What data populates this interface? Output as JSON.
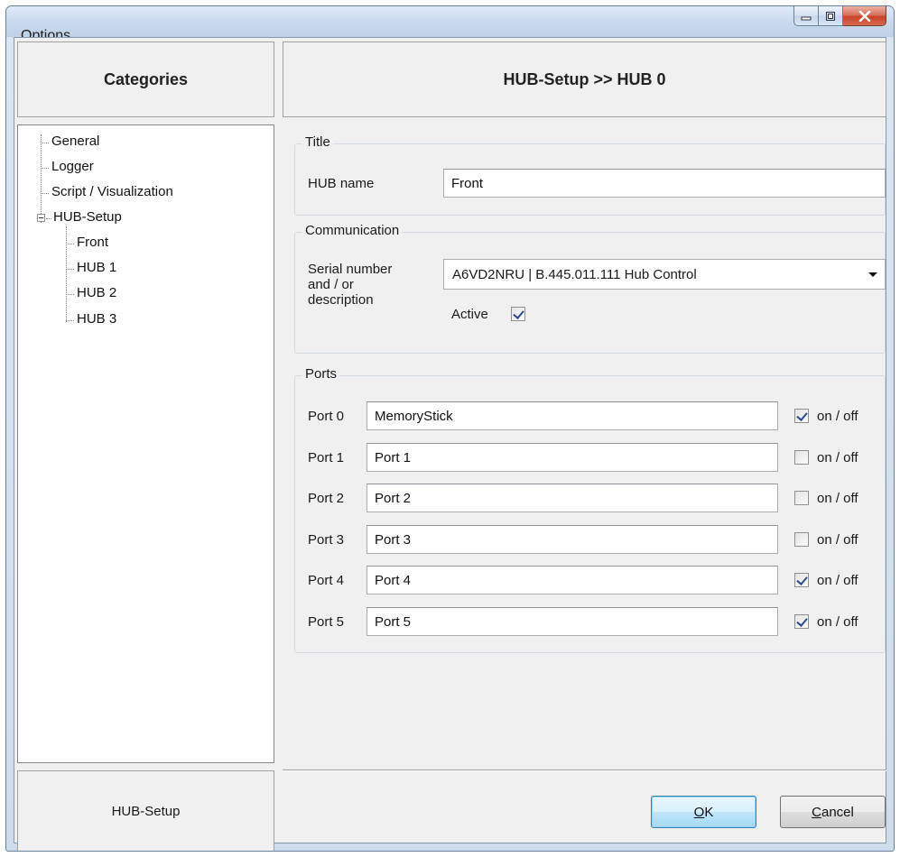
{
  "window": {
    "title": "Options"
  },
  "left_panel": {
    "header": "Categories",
    "tree": {
      "items": [
        {
          "label": "General"
        },
        {
          "label": "Logger"
        },
        {
          "label": "Script / Visualization"
        },
        {
          "label": "HUB-Setup"
        },
        {
          "label": "Front"
        },
        {
          "label": "HUB 1"
        },
        {
          "label": "HUB 2"
        },
        {
          "label": "HUB 3"
        }
      ]
    },
    "footer": "HUB-Setup"
  },
  "right_panel": {
    "header": "HUB-Setup >> HUB 0",
    "title_group": {
      "legend": "Title",
      "hub_name_label": "HUB name",
      "hub_name_value": "Front"
    },
    "communication_group": {
      "legend": "Communication",
      "serial_label_line1": "Serial number",
      "serial_label_line2": "and / or",
      "serial_label_line3": "description",
      "serial_value": "A6VD2NRU | B.445.011.111 Hub Control",
      "active_label": "Active",
      "active_checked": true
    },
    "ports_group": {
      "legend": "Ports",
      "ports": [
        {
          "label": "Port 0",
          "value": "MemoryStick",
          "toggle_label": "on / off",
          "checked": true
        },
        {
          "label": "Port 1",
          "value": "Port 1",
          "toggle_label": "on / off",
          "checked": false
        },
        {
          "label": "Port 2",
          "value": "Port 2",
          "toggle_label": "on / off",
          "checked": false
        },
        {
          "label": "Port 3",
          "value": "Port 3",
          "toggle_label": "on / off",
          "checked": false
        },
        {
          "label": "Port 4",
          "value": "Port 4",
          "toggle_label": "on / off",
          "checked": true
        },
        {
          "label": "Port 5",
          "value": "Port 5",
          "toggle_label": "on / off",
          "checked": true
        }
      ]
    }
  },
  "buttons": {
    "ok_accel": "O",
    "ok_rest": "K",
    "cancel_accel": "C",
    "cancel_rest": "ancel"
  },
  "icons": {
    "minimize": "minimize-icon",
    "maximize": "maximize-icon",
    "close": "close-icon",
    "tree_collapse": "collapse-icon",
    "dropdown": "chevron-down-icon"
  }
}
